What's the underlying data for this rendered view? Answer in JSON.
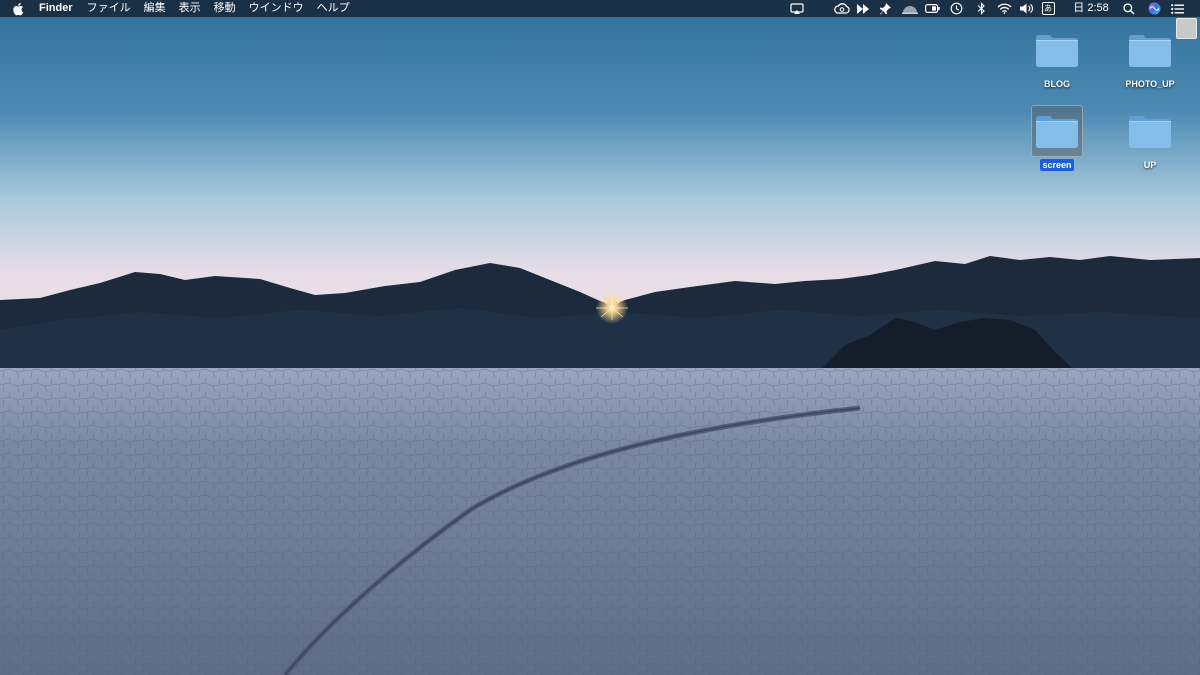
{
  "menubar": {
    "app_name": "Finder",
    "menus": [
      "ファイル",
      "編集",
      "表示",
      "移動",
      "ウインドウ",
      "ヘルプ"
    ],
    "status_icons": [
      "airplay-icon",
      "creative-cloud-icon",
      "fast-forward-icon",
      "pin-icon",
      "cloud-app-icon",
      "battery-icon",
      "time-machine-icon",
      "bluetooth-icon",
      "wifi-icon",
      "volume-icon",
      "input-method-icon"
    ],
    "input_method_label": "あ",
    "clock": "日 2:58",
    "right_icons": [
      "spotlight-icon",
      "siri-icon",
      "notification-center-icon"
    ]
  },
  "desktop": {
    "icons": [
      {
        "label": "BLOG",
        "kind": "folder",
        "selected": false
      },
      {
        "label": "PHOTO_UP",
        "kind": "folder",
        "selected": false
      },
      {
        "label": "screen",
        "kind": "folder",
        "selected": true
      },
      {
        "label": "UP",
        "kind": "folder",
        "selected": false
      }
    ],
    "wallpaper": "desert-playa-dusk"
  },
  "colors": {
    "menubar_bg": "#162232",
    "selection_blue": "#1a5fd6",
    "folder_blue": "#7fb9e6"
  }
}
